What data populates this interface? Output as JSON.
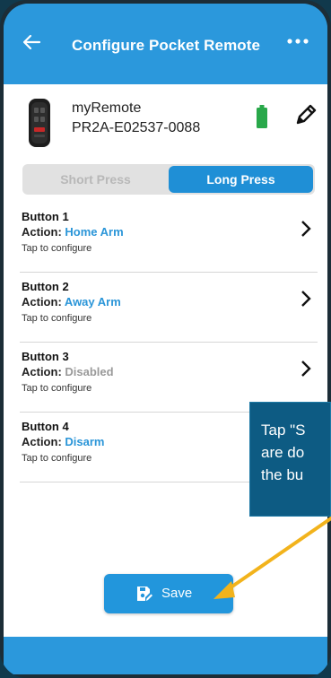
{
  "header": {
    "back_icon": "arrow-left-icon",
    "title": "Configure Pocket Remote",
    "more_icon": "more-horizontal-icon"
  },
  "device": {
    "name": "myRemote",
    "serial": "PR2A-E02537-0088",
    "battery_icon": "battery-full-icon",
    "edit_icon": "pencil-icon",
    "battery_color": "#29a84a"
  },
  "press_mode": {
    "options": [
      "Short Press",
      "Long Press"
    ],
    "selected": "Long Press"
  },
  "buttons": [
    {
      "name": "Button 1",
      "action_label": "Action:",
      "action": "Home Arm",
      "hint": "Tap to configure"
    },
    {
      "name": "Button 2",
      "action_label": "Action:",
      "action": "Away Arm",
      "hint": "Tap to configure"
    },
    {
      "name": "Button 3",
      "action_label": "Action:",
      "action": "Disabled",
      "hint": "Tap to configure"
    },
    {
      "name": "Button 4",
      "action_label": "Action:",
      "action": "Disarm",
      "hint": "Tap to configure"
    }
  ],
  "save": {
    "label": "Save",
    "icon": "save-edit-icon"
  },
  "callout": {
    "lines": [
      "Tap \"S",
      "are do",
      "the bu"
    ]
  },
  "colors": {
    "accent": "#2b98dc",
    "action_value": "#2a95d8",
    "disabled_value": "#9a9a9a",
    "callout_bg": "#0d5b83",
    "arrow": "#f2b31c"
  }
}
